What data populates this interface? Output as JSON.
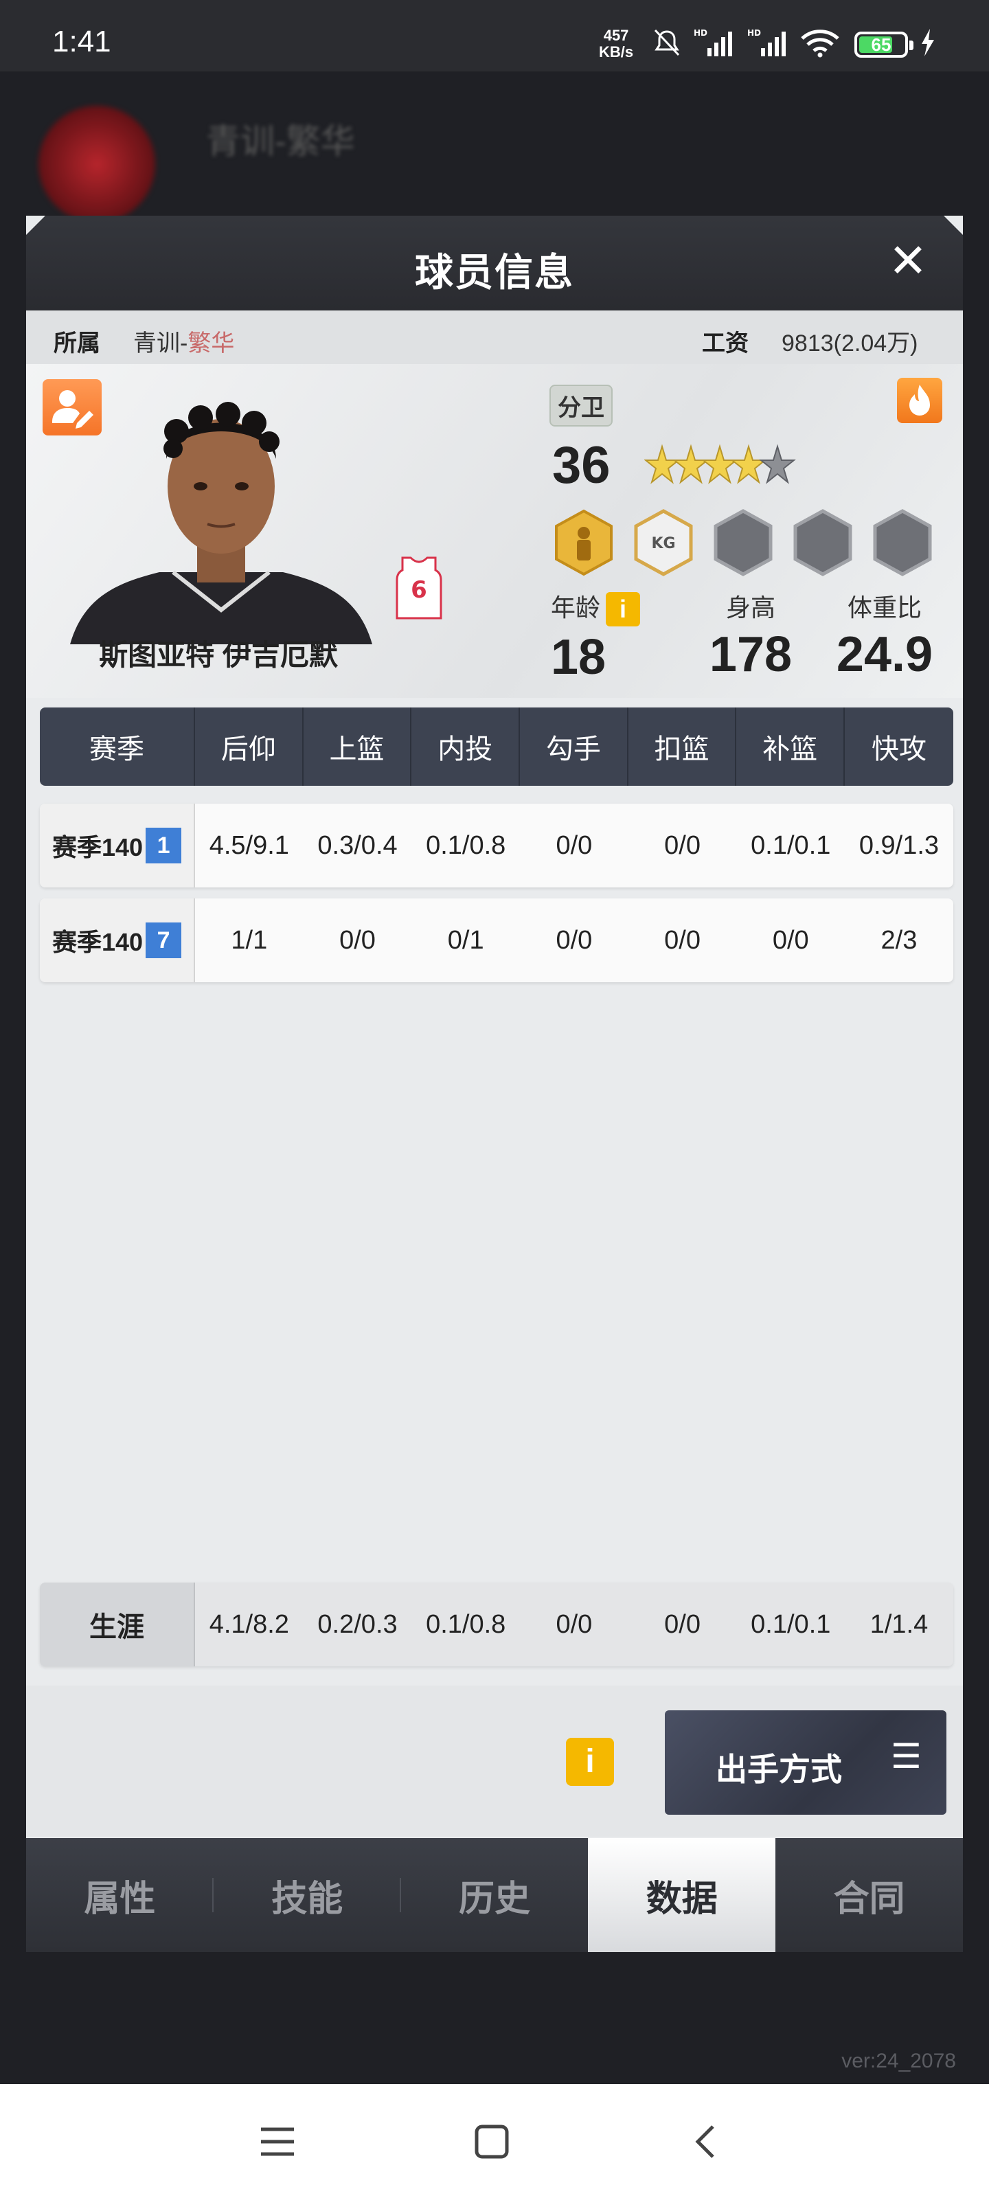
{
  "status_bar": {
    "time": "1:41",
    "net_speed": "457",
    "net_unit": "KB/s",
    "battery": "65"
  },
  "modal": {
    "title": "球员信息",
    "close_label": "✕",
    "affiliation_label": "所属",
    "affiliation_prefix": "青训-",
    "affiliation_name": "繁华",
    "salary_label": "工资",
    "salary_value": "9813(2.04万)"
  },
  "player": {
    "name": "斯图亚特 伊吉厄默",
    "jersey_number": "6",
    "position": "分卫",
    "rating": "36",
    "stars": 3.5,
    "age_label": "年龄",
    "age": "18",
    "height_label": "身高",
    "height": "178",
    "weight_ratio_label": "体重比",
    "weight_ratio": "24.9",
    "info_icon": "i"
  },
  "stats_table": {
    "headers": [
      "赛季",
      "后仰",
      "上篮",
      "内投",
      "勾手",
      "扣篮",
      "补篮",
      "快攻"
    ],
    "rows": [
      {
        "season": "赛季140",
        "badge": "1",
        "values": [
          "4.5/9.1",
          "0.3/0.4",
          "0.1/0.8",
          "0/0",
          "0/0",
          "0.1/0.1",
          "0.9/1.3"
        ]
      },
      {
        "season": "赛季140",
        "badge": "7",
        "values": [
          "1/1",
          "0/0",
          "0/1",
          "0/0",
          "0/0",
          "0/0",
          "2/3"
        ]
      }
    ],
    "career": {
      "label": "生涯",
      "values": [
        "4.1/8.2",
        "0.2/0.3",
        "0.1/0.8",
        "0/0",
        "0/0",
        "0.1/0.1",
        "1/1.4"
      ]
    }
  },
  "actions": {
    "info_icon": "i",
    "shoot_mode_label": "出手方式",
    "menu_glyph": "☰"
  },
  "tabs": [
    "属性",
    "技能",
    "历史",
    "数据",
    "合同"
  ],
  "active_tab": "数据",
  "version": "ver:24_2078",
  "background": {
    "title": "青训-繁华"
  }
}
